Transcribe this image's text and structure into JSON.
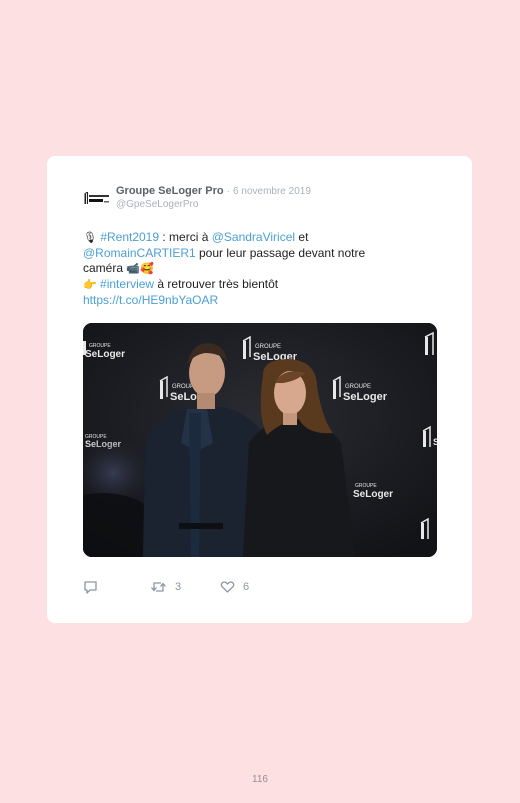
{
  "tweet": {
    "author_name": "Groupe SeLoger Pro",
    "separator": "·",
    "date": "6 novembre 2019",
    "handle": "@GpeSeLogerPro",
    "line1": {
      "emoji1": "🎙",
      "hashtag1": "#Rent2019",
      "text1": " : merci à ",
      "mention1": "@SandraViricel",
      "text2": " et"
    },
    "line2": {
      "mention2": "@RomainCARTIER1",
      "text3": " pour leur passage devant notre"
    },
    "line3": {
      "text4": "caméra ",
      "emoji2": "📹🥰"
    },
    "line4": {
      "emoji3": "👉",
      "hashtag2": "#interview",
      "text5": " à retrouver très bientôt"
    },
    "line5": {
      "url": "https://t.co/HE9nbYaOAR"
    },
    "photo": {
      "backdrop_brand_top": "GROUPE",
      "backdrop_brand": "SeLoger",
      "backdrop_brand_short": "Se"
    },
    "actions": {
      "reply_icon": "reply-icon",
      "retweet_icon": "retweet-icon",
      "retweet_count": "3",
      "like_icon": "heart-icon",
      "like_count": "6"
    }
  },
  "page_number": "116",
  "colors": {
    "page_background": "#fde0e1",
    "link": "#4a9fd5",
    "card": "#ffffff"
  }
}
